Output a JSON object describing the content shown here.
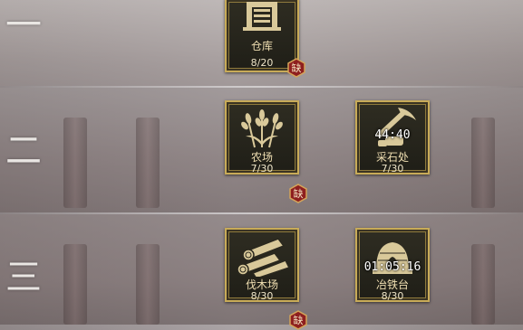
{
  "tiers": [
    {
      "label": "一"
    },
    {
      "label": "二"
    },
    {
      "label": "三"
    }
  ],
  "buildings": [
    {
      "name": "仓库",
      "count": "8/20",
      "shortage": "缺",
      "icon": "warehouse-icon"
    },
    {
      "name": "农场",
      "count": "7/30",
      "shortage": "缺",
      "icon": "wheat-icon"
    },
    {
      "name": "采石处",
      "count": "7/30",
      "timer": "44:40",
      "icon": "pickaxe-icon"
    },
    {
      "name": "伐木场",
      "count": "8/30",
      "shortage": "缺",
      "icon": "logs-icon"
    },
    {
      "name": "冶铁台",
      "count": "8/30",
      "timer": "01:05:16",
      "icon": "furnace-icon"
    }
  ],
  "colors": {
    "card_border": "#c8ab58",
    "shortage_badge": "#8e1f1f",
    "text": "#f0dfb2"
  }
}
